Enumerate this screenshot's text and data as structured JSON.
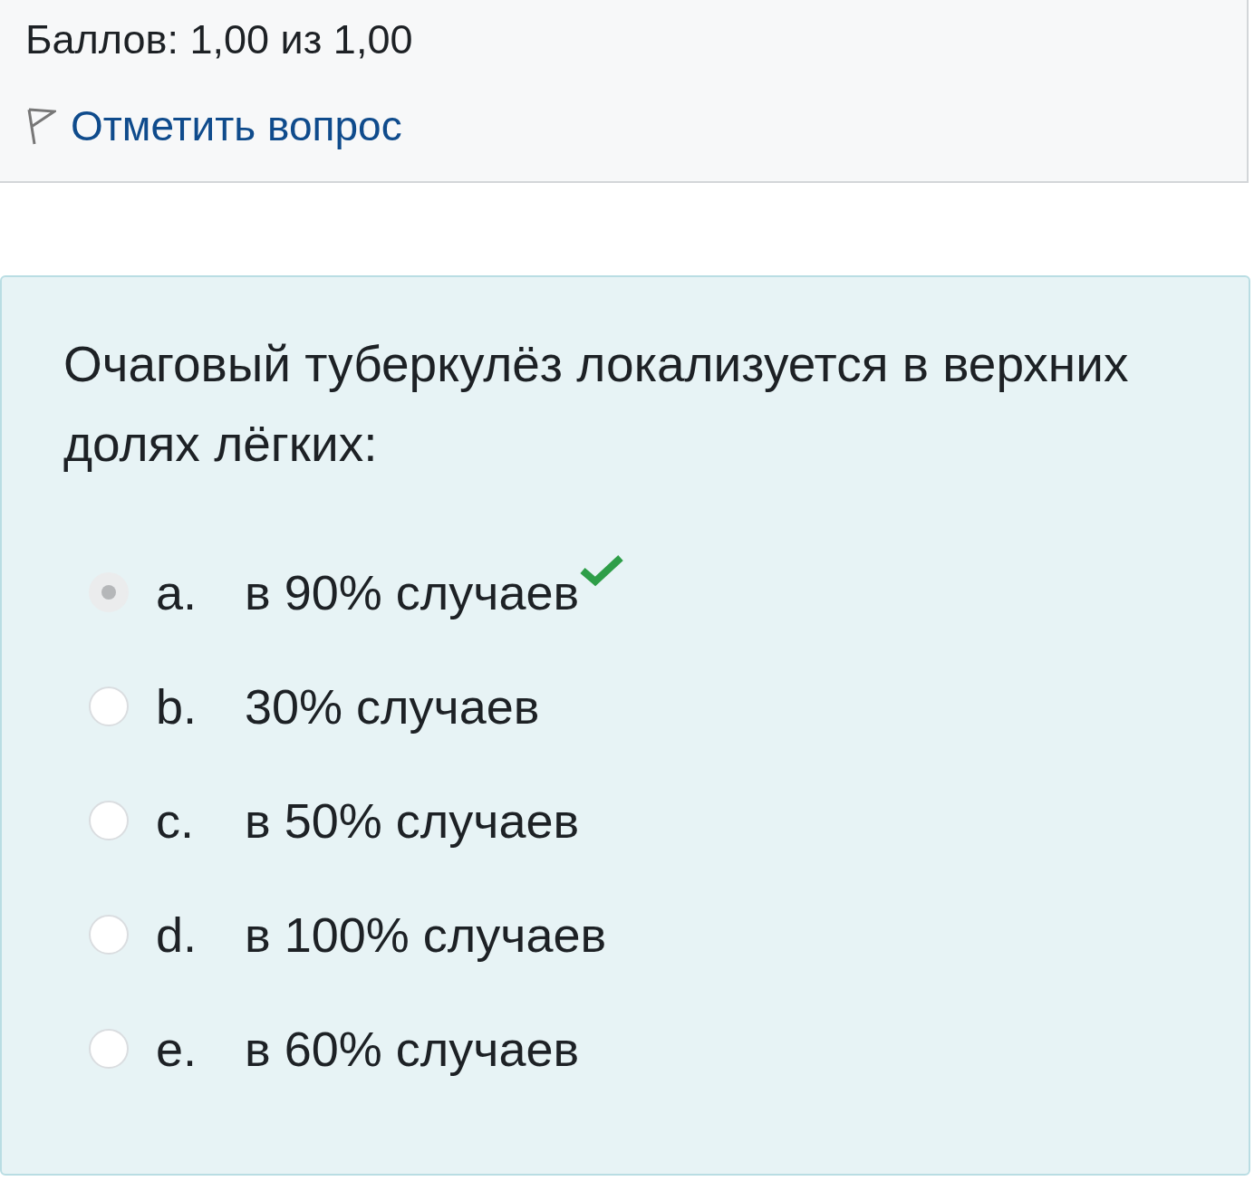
{
  "info": {
    "grade": "Баллов: 1,00 из 1,00",
    "flag_link": "Отметить вопрос"
  },
  "question": {
    "text": "Очаговый туберкулёз локализуется в верхних долях лёгких:",
    "options": [
      {
        "letter": "a.",
        "text": "в 90% случаев",
        "selected": true,
        "correct": true
      },
      {
        "letter": "b.",
        "text": "30% случаев",
        "selected": false,
        "correct": false
      },
      {
        "letter": "c.",
        "text": "в 50% случаев",
        "selected": false,
        "correct": false
      },
      {
        "letter": "d.",
        "text": "в 100% случаев",
        "selected": false,
        "correct": false
      },
      {
        "letter": "e.",
        "text": "в 60% случаев",
        "selected": false,
        "correct": false
      }
    ]
  }
}
